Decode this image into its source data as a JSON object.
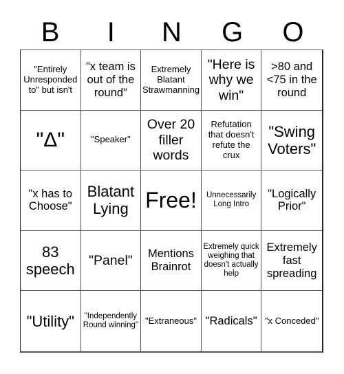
{
  "title_letters": [
    "B",
    "I",
    "N",
    "G",
    "O"
  ],
  "cells": [
    {
      "text": "\"Entirely Unresponded to\" but isn't",
      "size": "s-sm"
    },
    {
      "text": "\"x team is out of the round\"",
      "size": "s-md"
    },
    {
      "text": "Extremely Blatant Strawmanning",
      "size": "s-sm"
    },
    {
      "text": "\"Here is why we win\"",
      "size": "s-lg"
    },
    {
      "text": ">80 and <75 in the round",
      "size": "s-md"
    },
    {
      "text": "\"Δ\"",
      "size": "s-xxl"
    },
    {
      "text": "\"Speaker\"",
      "size": "s-sm"
    },
    {
      "text": "Over 20 filler words",
      "size": "s-lg"
    },
    {
      "text": "Refutation that doesn't refute the crux",
      "size": "s-sm"
    },
    {
      "text": "\"Swing Voters\"",
      "size": "s-xl"
    },
    {
      "text": "\"x has to Choose\"",
      "size": "s-md"
    },
    {
      "text": "Blatant Lying",
      "size": "s-xl"
    },
    {
      "text": "Free!",
      "size": "s-free"
    },
    {
      "text": "Unnecessarily Long Intro",
      "size": "s-xs"
    },
    {
      "text": "\"Logically Prior\"",
      "size": "s-md"
    },
    {
      "text": "83 speech",
      "size": "s-xl"
    },
    {
      "text": "\"Panel\"",
      "size": "s-lg"
    },
    {
      "text": "Mentions Brainrot",
      "size": "s-md"
    },
    {
      "text": "Extremely quick weighing that doesn't actually help",
      "size": "s-xs"
    },
    {
      "text": "Extremely fast spreading",
      "size": "s-md"
    },
    {
      "text": "\"Utility\"",
      "size": "s-xl"
    },
    {
      "text": "\"Independently Round winning\"",
      "size": "s-xs"
    },
    {
      "text": "\"Extraneous\"",
      "size": "s-sm"
    },
    {
      "text": "\"Radicals\"",
      "size": "s-md"
    },
    {
      "text": "\"x Conceded\"",
      "size": "s-sm"
    }
  ]
}
